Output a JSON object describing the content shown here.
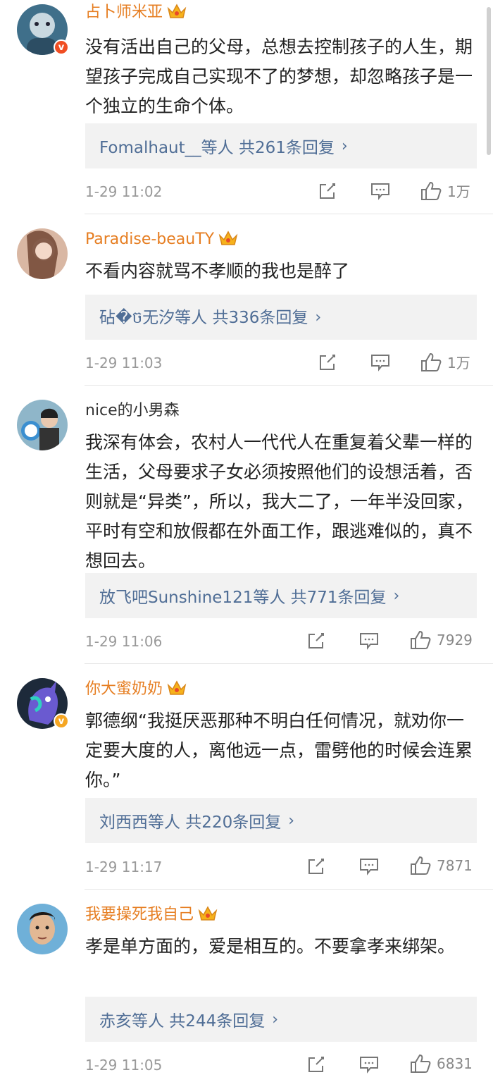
{
  "colors": {
    "username_accent": "#e67e22",
    "reply_link": "#506e96",
    "meta_gray": "#999999",
    "verified_red": "#f04e23",
    "verified_orange": "#f5a623"
  },
  "comments": [
    {
      "username": "占卜师米亚",
      "vip": true,
      "verified": "red",
      "content": "没有活出自己的父母，总想去控制孩子的人生，期望孩子完成自己实现不了的梦想，却忽略孩子是一个独立的生命个体。",
      "reply_preview": "Fomalhaut__等人  共261条回复",
      "time": "1-29 11:02",
      "likes": "1万"
    },
    {
      "username": "Paradise-beauTY",
      "vip": true,
      "verified": null,
      "content": "不看内容就骂不孝顺的我也是醉了",
      "reply_preview": "砧�ច无汐等人  共336条回复",
      "time": "1-29 11:03",
      "likes": "1万"
    },
    {
      "username": "nice的小男森",
      "vip": false,
      "verified": null,
      "content": "我深有体会，农村人一代代人在重复着父辈一样的生活，父母要求子女必须按照他们的设想活着，否则就是“异类”，所以，我大二了，一年半没回家，平时有空和放假都在外面工作，跟逃难似的，真不想回去。",
      "reply_preview": "放飞吧Sunshine121等人  共771条回复",
      "time": "1-29 11:06",
      "likes": "7929"
    },
    {
      "username": "你大蜜奶奶",
      "vip": true,
      "verified": "orange",
      "content": "郭德纲“我挺厌恶那种不明白任何情况，就劝你一定要大度的人，离他远一点，雷劈他的时候会连累你。”",
      "reply_preview": "刘西西等人  共220条回复",
      "time": "1-29 11:17",
      "likes": "7871"
    },
    {
      "username": "我要操死我自己",
      "vip": true,
      "verified": null,
      "content": "孝是单方面的，爱是相互的。不要拿孝来绑架。",
      "reply_preview": "赤亥等人  共244条回复",
      "time": "1-29 11:05",
      "likes": "6831"
    }
  ]
}
